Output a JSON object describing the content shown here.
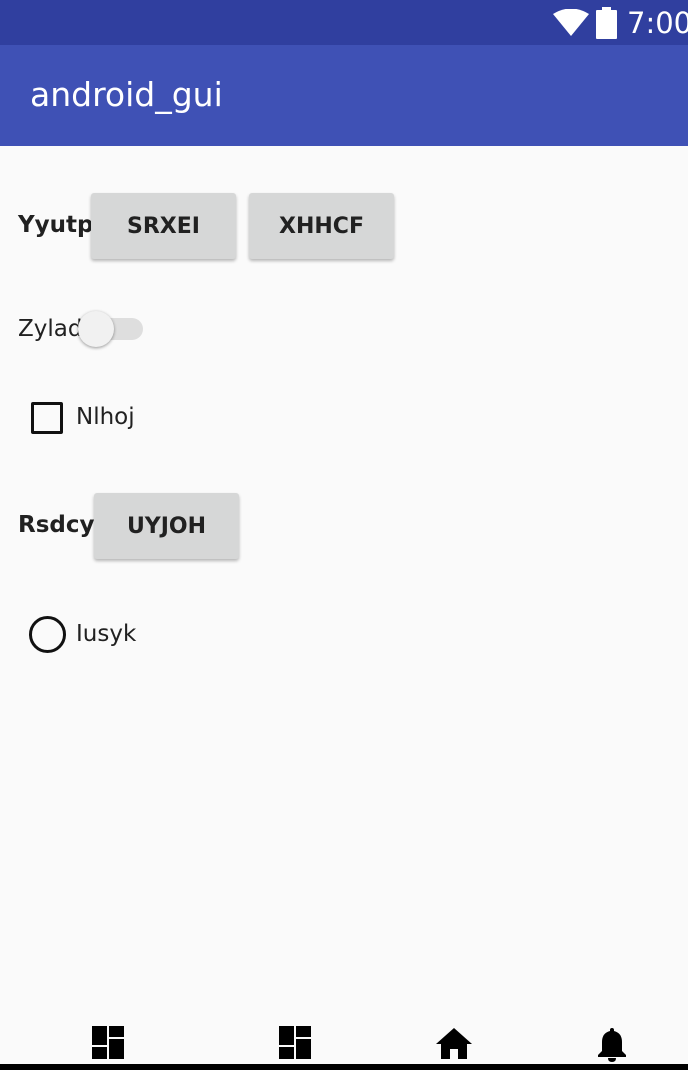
{
  "status_bar": {
    "time": "7:00",
    "icons": [
      "wifi-icon",
      "battery-icon"
    ],
    "background": "#303f9f"
  },
  "app_bar": {
    "title": "android_gui",
    "background": "#3f51b5"
  },
  "content": {
    "row1": {
      "label": "Yyutp",
      "buttons": [
        "SRXEI",
        "XHHCF"
      ]
    },
    "row2": {
      "label": "Zylad",
      "switch_on": false
    },
    "row3": {
      "checkbox_label": "Nlhoj",
      "checked": false
    },
    "row4": {
      "label": "Rsdcy",
      "button": "UYJOH"
    },
    "row5": {
      "radio_label": "Iusyk",
      "selected": false
    }
  },
  "bottom_nav": {
    "icons": [
      "dashboard-icon",
      "dashboard-icon",
      "home-icon",
      "bell-icon"
    ]
  },
  "colors": {
    "button_bg": "#d6d7d7",
    "page_bg": "#fafafa"
  }
}
